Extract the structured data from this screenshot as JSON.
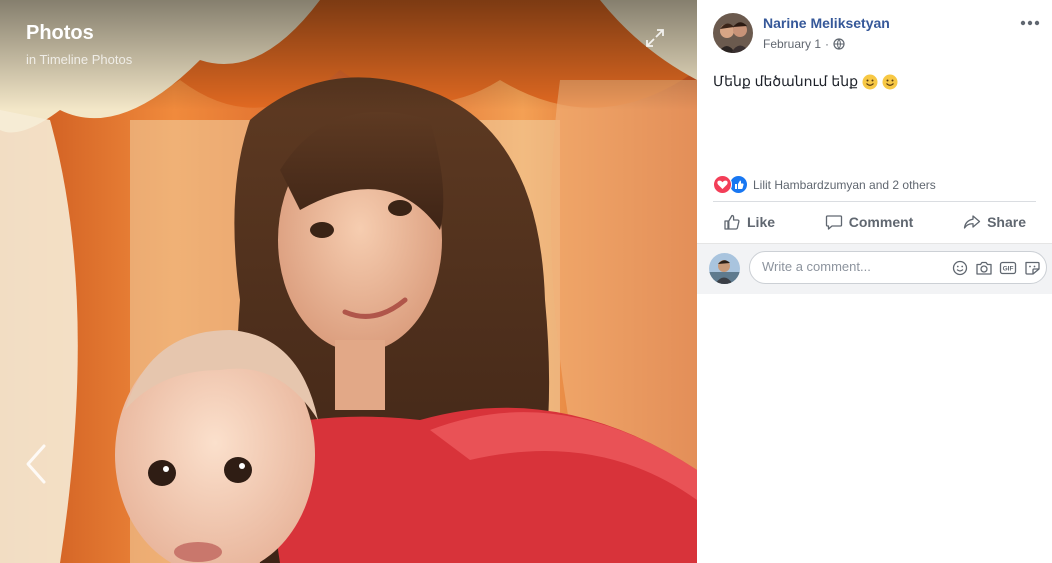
{
  "viewer": {
    "title": "Photos",
    "subtitle": "in Timeline Photos",
    "expand_icon": "expand-icon",
    "prev_icon": "chevron-left-icon"
  },
  "post": {
    "author": "Narine Meliksetyan",
    "date": "February 1",
    "separator": "·",
    "privacy_icon": "globe-icon",
    "text": "Մենք մեծանում ենք",
    "emojis": [
      "smile-emoji",
      "smile-emoji"
    ]
  },
  "reactions": {
    "icons": [
      "love-reaction-icon",
      "like-reaction-icon"
    ],
    "summary": "Lilit Hambardzumyan and 2 others"
  },
  "actions": {
    "like": "Like",
    "comment": "Comment",
    "share": "Share"
  },
  "comment_box": {
    "placeholder": "Write a comment...",
    "icons": [
      "emoji-icon",
      "camera-icon",
      "gif-icon",
      "sticker-icon"
    ]
  },
  "colors": {
    "link_blue": "#365899",
    "love_red": "#f33e58",
    "like_blue": "#1877f2",
    "text_gray": "#606770"
  }
}
